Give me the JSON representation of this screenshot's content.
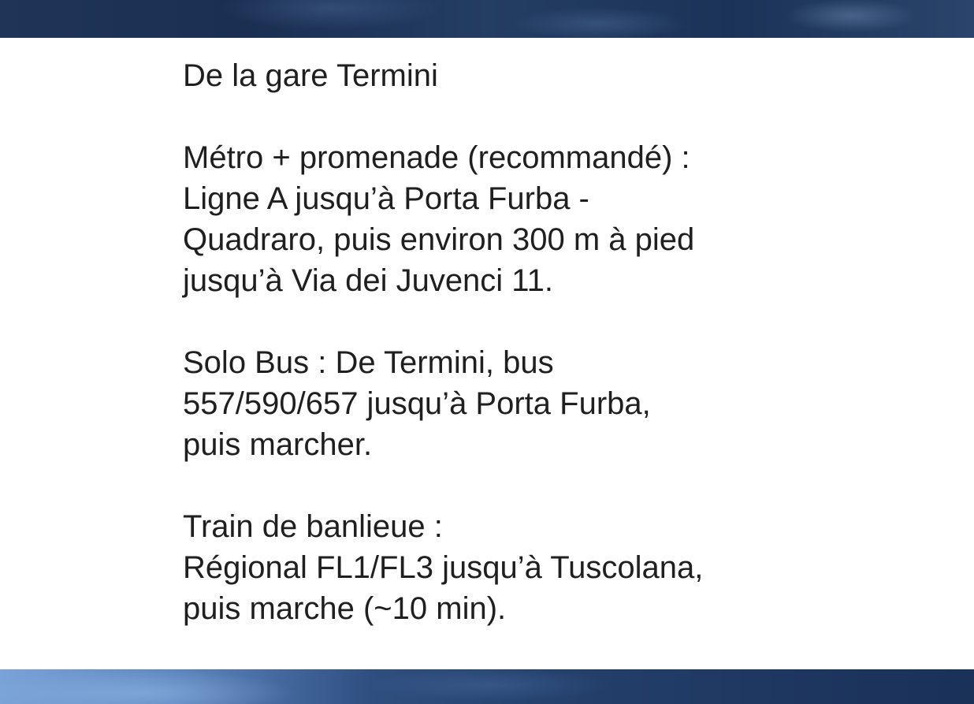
{
  "slide": {
    "heading": "De la gare Termini",
    "sections": [
      {
        "lines": [
          "Métro + promenade (recommandé) :",
          "Ligne A jusqu’à Porta Furba -",
          "Quadraro, puis environ 300 m à pied",
          "jusqu’à Via dei Juvenci 11."
        ]
      },
      {
        "lines": [
          "Solo Bus : De Termini, bus",
          "557/590/657 jusqu’à Porta Furba,",
          "puis marcher."
        ]
      },
      {
        "lines": [
          "Train de banlieue :",
          "Régional FL1/FL3 jusqu’à Tuscolana,",
          "puis marche (~10 min)."
        ]
      }
    ]
  },
  "colors": {
    "text": "#1f1f1f",
    "background": "#ffffff",
    "banner": "#1f3557"
  }
}
